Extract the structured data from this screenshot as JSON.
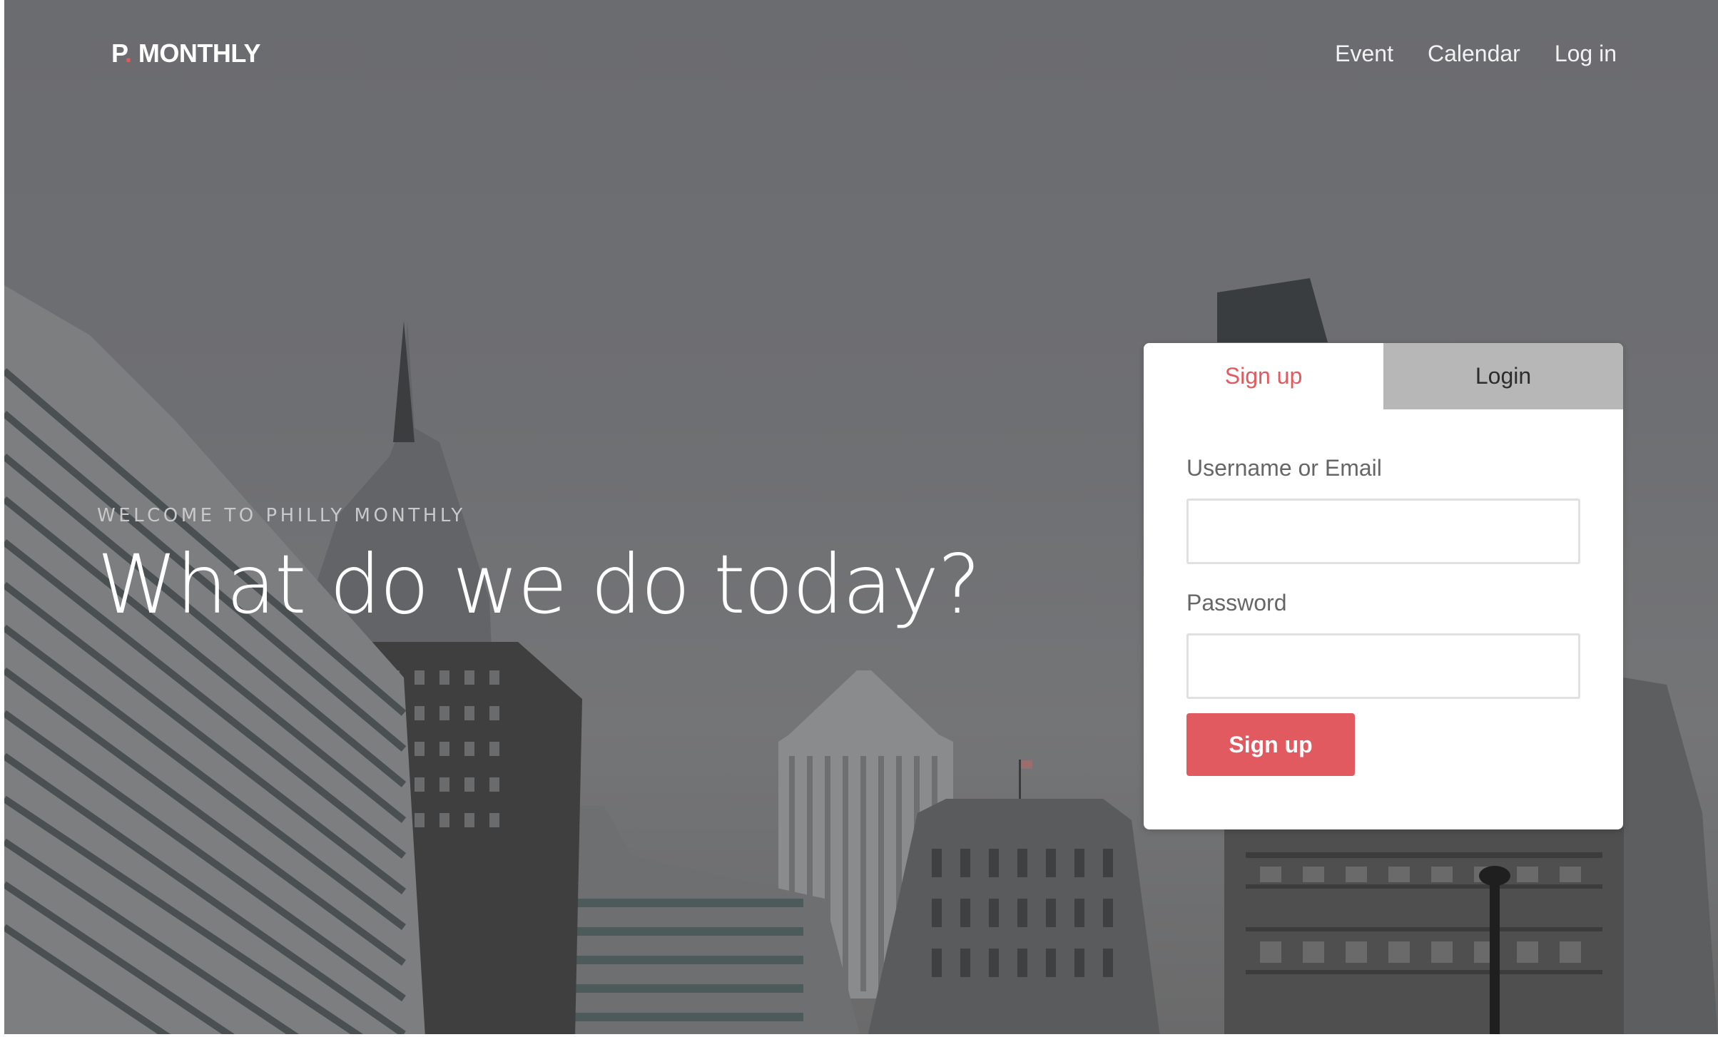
{
  "header": {
    "brand_prefix": "P",
    "brand_dot": ".",
    "brand_suffix": " MONTHLY",
    "nav": [
      {
        "label": "Event"
      },
      {
        "label": "Calendar"
      },
      {
        "label": "Log in"
      }
    ]
  },
  "hero": {
    "eyebrow": "WELCOME TO PHILLY MONTHLY",
    "headline": "What do we do today?"
  },
  "auth": {
    "tabs": [
      {
        "label": "Sign up",
        "active": true
      },
      {
        "label": "Login",
        "active": false
      }
    ],
    "username_label": "Username or Email",
    "username_value": "",
    "password_label": "Password",
    "password_value": "",
    "submit_label": "Sign up"
  },
  "colors": {
    "accent": "#e05a5f",
    "overlay": "#6e6f72",
    "inactive_tab": "#b7b7b7"
  }
}
